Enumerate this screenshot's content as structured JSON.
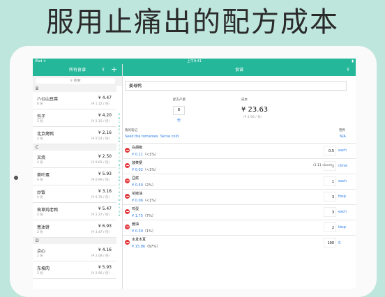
{
  "headline": "服用止痛出的配方成本",
  "status": {
    "left": "iPad ✈",
    "time": "上午9:41",
    "right": "▮"
  },
  "left": {
    "title": "所有食谱",
    "search_placeholder": "搜索",
    "sections": [
      {
        "letter": "B",
        "items": [
          {
            "name": "八公山豆腐",
            "servings": "8 份",
            "price": "¥ 4.47",
            "per": "（¥ 1.12 / 份）"
          },
          {
            "name": "包子",
            "servings": "2 份",
            "price": "¥ 4.20",
            "per": "（¥ 2.10 / 份）"
          },
          {
            "name": "北京烤鸭",
            "servings": "4 份",
            "price": "¥ 2.16",
            "per": "（¥ 0.54 / 份）"
          }
        ]
      },
      {
        "letter": "C",
        "items": [
          {
            "name": "叉烧",
            "servings": "4 份",
            "price": "¥ 2.50",
            "per": "（¥ 0.62 / 份）"
          },
          {
            "name": "茶叶蛋",
            "servings": "6 份",
            "price": "¥ 5.93",
            "per": "（¥ 0.99 / 份）"
          },
          {
            "name": "炒饭",
            "servings": "4 份",
            "price": "¥ 3.16",
            "per": "（¥ 0.79 / 份）"
          },
          {
            "name": "虫草炖老鸭",
            "servings": "4 份",
            "price": "¥ 5.47",
            "per": "（¥ 1.37 / 份）"
          },
          {
            "name": "葱油饼",
            "servings": "2 份",
            "price": "¥ 6.93",
            "per": "（¥ 3.47 / 份）"
          }
        ]
      },
      {
        "letter": "D",
        "items": [
          {
            "name": "点心",
            "servings": "2 份",
            "price": "¥ 4.16",
            "per": "（¥ 2.08 / 份）"
          },
          {
            "name": "东坡肉",
            "servings": "2 份",
            "price": "¥ 5.93",
            "per": "（¥ 2.96 / 份）"
          }
        ]
      }
    ],
    "index": [
      "A",
      "B",
      "C",
      "D",
      "E",
      "F",
      "G",
      "H",
      "I",
      "J",
      "K",
      "L",
      "M",
      "N",
      "O",
      "P",
      "Q",
      "R",
      "S",
      "T",
      "U",
      "V",
      "W",
      "X",
      "Y",
      "Z",
      "#"
    ]
  },
  "right": {
    "title": "食谱",
    "recipe_name": "姜母鸭",
    "yield_label": "配方产量",
    "servings_value": "8",
    "servings_unit": "份",
    "cost_label": "成本",
    "cost": "¥ 23.63",
    "cost_per": "（¥ 2.95 / 份）",
    "notes_label": "我的笔记",
    "notes": "Seed the tomatoes. Serve cold.",
    "nutrition_label": "营养",
    "nutrition_value": "N/A",
    "ingredients": [
      {
        "name": "白胡椒",
        "cost": "¥ 0.11",
        "pct": "（<1%）",
        "note": "",
        "qty": "0.5",
        "unit": "each"
      },
      {
        "name": "菠菜梗",
        "cost": "¥ 0.02",
        "pct": "（<1%）",
        "note": "(1.11 clove)",
        "qty": "1",
        "unit": "clove"
      },
      {
        "name": "豆腐",
        "cost": "¥ 0.50",
        "pct": "（2%）",
        "note": "",
        "qty": "1",
        "unit": "each"
      },
      {
        "name": "花椒油",
        "cost": "¥ 0.06",
        "pct": "（<1%）",
        "note": "",
        "qty": "3",
        "unit": "tbsp"
      },
      {
        "name": "鸡蛋",
        "cost": "¥ 1.75",
        "pct": "（7%）",
        "note": "",
        "qty": "3",
        "unit": "each"
      },
      {
        "name": "酱油",
        "cost": "¥ 0.30",
        "pct": "（1%）",
        "note": "",
        "qty": "2",
        "unit": "tbsp"
      },
      {
        "name": "水发木耳",
        "cost": "¥ 15.86",
        "pct": "（67%）",
        "note": "",
        "qty": "100",
        "unit": "g"
      }
    ]
  },
  "colors": {
    "accent": "#25b79a",
    "link": "#2a7be4",
    "delete": "#e5383b",
    "background": "#bfe6dc"
  },
  "icons": {
    "share": "share-icon",
    "add": "plus-icon",
    "delete": "delete-icon",
    "search": "search-icon"
  }
}
